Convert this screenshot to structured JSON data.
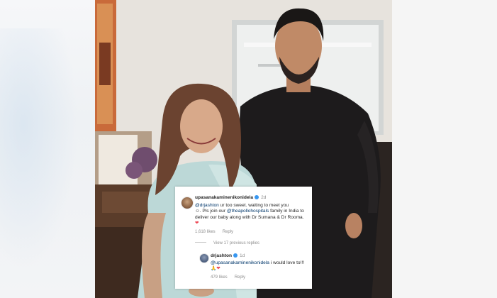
{
  "comment": {
    "username": "upasanakaminenikonidela",
    "time": "2d",
    "mention1": "@drjashton",
    "text1": " ur too sweet. waiting to meet you",
    "text2": ". Pls join our ",
    "mention2": "@theapollohospitals",
    "text3": " family in India to deliver our baby along with Dr Sumana & Dr Rooma.",
    "likes": "1,618 likes",
    "reply": "Reply",
    "view_replies": "View 17 previous replies"
  },
  "reply_comment": {
    "username": "drjashton",
    "time": "1d",
    "mention": "@upasanakaminenikonidela",
    "text": " i would love to!!!",
    "likes": "479 likes",
    "reply": "Reply"
  },
  "colors": {
    "verified": "#3897f0",
    "heart": "#ed4956",
    "mention": "#00376b"
  },
  "icons": [
    "verified-badge-icon",
    "heart-emoji-icon",
    "pray-emoji-icon",
    "smile-emoji-icon"
  ]
}
